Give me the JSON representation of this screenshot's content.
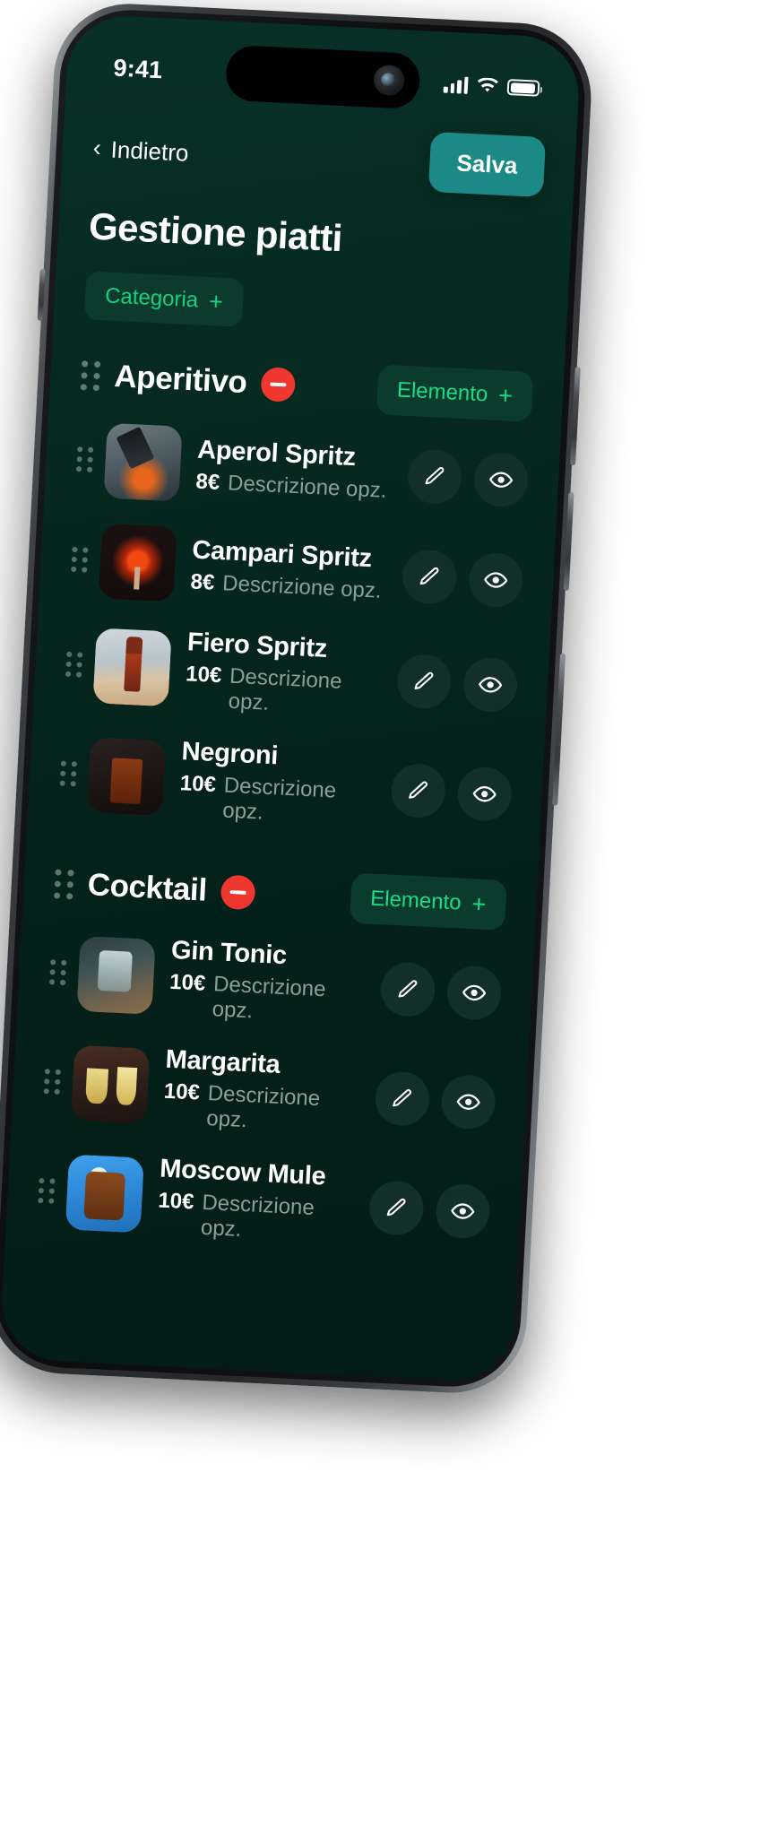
{
  "status_bar": {
    "time": "9:41",
    "signal_icon": "cellular-bars-icon",
    "wifi_icon": "wifi-icon",
    "battery_icon": "battery-icon"
  },
  "nav": {
    "back_label": "Indietro",
    "back_chevron": "‹",
    "save_label": "Salva"
  },
  "page": {
    "title": "Gestione piatti",
    "add_category_label": "Categoria",
    "plus_glyph": "+"
  },
  "colors": {
    "screen_bg": "#05221b",
    "accent_teal": "#1b8a86",
    "accent_green": "#18dd86",
    "pill_green_bg": "#0b3b2c",
    "danger_red": "#f0372f",
    "muted_text": "#8e9e98"
  },
  "sections": [
    {
      "title": "Aperitivo",
      "remove_icon": "minus-circle-icon",
      "add_item_label": "Elemento",
      "items": [
        {
          "name": "Aperol Spritz",
          "price": "8€",
          "description": "Descrizione opz.",
          "art": "aperol",
          "edit_icon": "pencil-icon",
          "view_icon": "eye-icon"
        },
        {
          "name": "Campari Spritz",
          "price": "8€",
          "description": "Descrizione opz.",
          "art": "campari",
          "edit_icon": "pencil-icon",
          "view_icon": "eye-icon"
        },
        {
          "name": "Fiero Spritz",
          "price": "10€",
          "description": "Descrizione opz.",
          "art": "fiero",
          "edit_icon": "pencil-icon",
          "view_icon": "eye-icon"
        },
        {
          "name": "Negroni",
          "price": "10€",
          "description": "Descrizione opz.",
          "art": "negroni",
          "edit_icon": "pencil-icon",
          "view_icon": "eye-icon"
        }
      ]
    },
    {
      "title": "Cocktail",
      "remove_icon": "minus-circle-icon",
      "add_item_label": "Elemento",
      "items": [
        {
          "name": "Gin Tonic",
          "price": "10€",
          "description": "Descrizione opz.",
          "art": "gintonic",
          "edit_icon": "pencil-icon",
          "view_icon": "eye-icon"
        },
        {
          "name": "Margarita",
          "price": "10€",
          "description": "Descrizione opz.",
          "art": "margarita",
          "edit_icon": "pencil-icon",
          "view_icon": "eye-icon"
        },
        {
          "name": "Moscow Mule",
          "price": "10€",
          "description": "Descrizione opz.",
          "art": "moscow",
          "edit_icon": "pencil-icon",
          "view_icon": "eye-icon"
        }
      ]
    }
  ]
}
